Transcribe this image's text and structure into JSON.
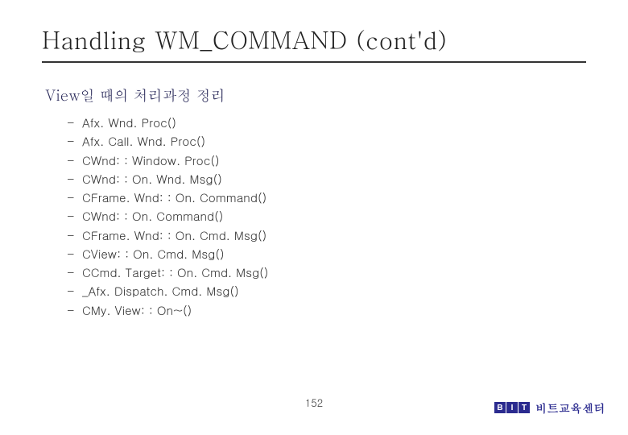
{
  "title": "Handling WM_COMMAND (cont'd)",
  "heading": "View일 때의 처리과정 정리",
  "items": [
    "Afx. Wnd. Proc()",
    "Afx. Call. Wnd. Proc()",
    "CWnd: : Window. Proc()",
    "CWnd: : On. Wnd. Msg()",
    "CFrame. Wnd: : On. Command()",
    "CWnd: : On. Command()",
    "CFrame. Wnd: : On. Cmd. Msg()",
    "CView: : On. Cmd. Msg()",
    "CCmd. Target: : On. Cmd. Msg()",
    "_Afx. Dispatch. Cmd. Msg()",
    "CMy. View: : On~()"
  ],
  "page_number": "152",
  "logo": {
    "b": "B",
    "i": "I",
    "t": "T",
    "text": "비트교육센터"
  }
}
